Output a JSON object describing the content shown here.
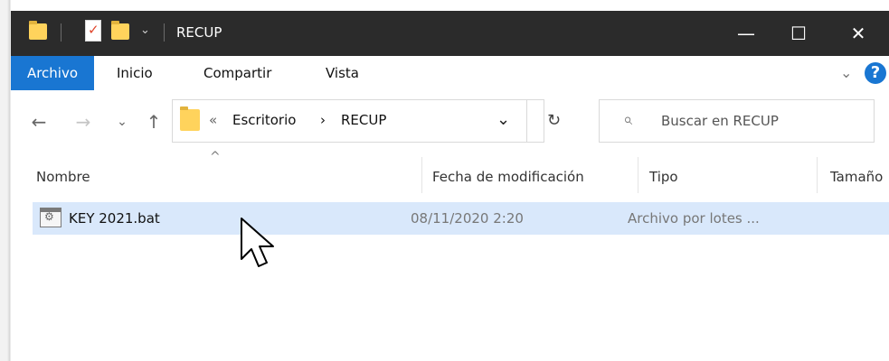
{
  "window": {
    "title": "RECUP",
    "qat_menu_symbol": "⌄",
    "caption": {
      "minimize": "—",
      "maximize": "☐",
      "close": "✕"
    }
  },
  "ribbon": {
    "tabs": [
      {
        "label": "Archivo",
        "active": true
      },
      {
        "label": "Inicio",
        "active": false
      },
      {
        "label": "Compartir",
        "active": false
      },
      {
        "label": "Vista",
        "active": false
      }
    ],
    "expand_icon": "⌄",
    "help_label": "?"
  },
  "navigation": {
    "back": "←",
    "forward": "→",
    "recent": "⌄",
    "up": "↑",
    "address": {
      "overflow": "«",
      "path": [
        "Escritorio",
        "RECUP"
      ],
      "separator": "›",
      "dropdown": "⌄",
      "refresh": "↻"
    },
    "search": {
      "placeholder": "Buscar en RECUP",
      "icon": "⌕"
    }
  },
  "columns": {
    "sort_indicator": "^",
    "headers": [
      "Nombre",
      "Fecha de modificación",
      "Tipo",
      "Tamaño"
    ]
  },
  "files": [
    {
      "name": "KEY 2021.bat",
      "modified": "08/11/2020 2:20",
      "type": "Archivo por lotes ...",
      "selected": true
    }
  ],
  "colors": {
    "titlebar": "#2b2b2b",
    "accent": "#1976d2",
    "selection": "#d9e8fb",
    "folder": "#ffd35c"
  },
  "icons": {
    "title_folder": "folder-icon",
    "properties": "properties-icon",
    "new_folder": "new-folder-icon",
    "file": "batch-file-icon",
    "mouse_pointer": "mouse-pointer-icon"
  }
}
